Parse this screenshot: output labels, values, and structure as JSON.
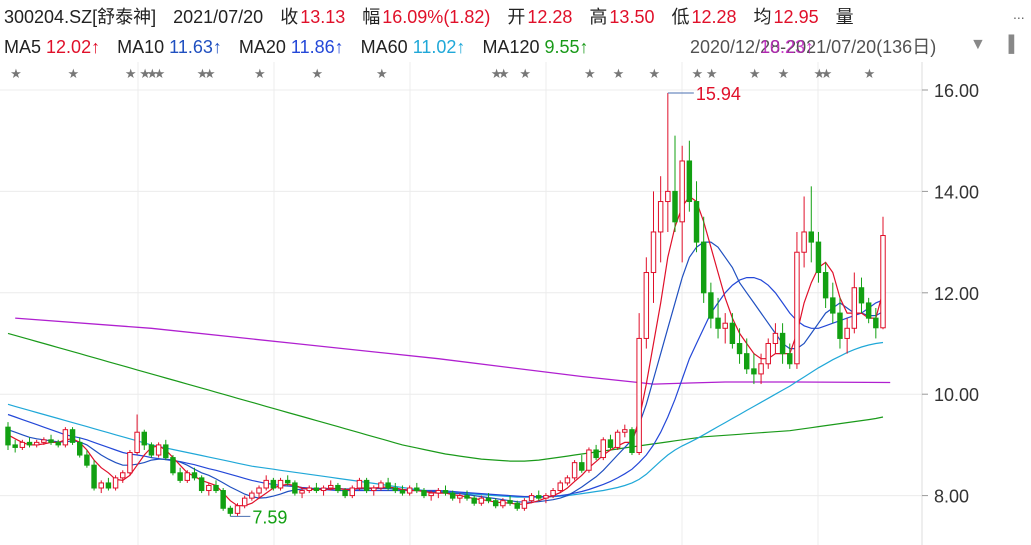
{
  "header": {
    "code": "300204.SZ[舒泰神]",
    "date": "2021/07/20",
    "close_label": "收",
    "close": "13.13",
    "change_label": "幅",
    "change": "16.09%(1.82)",
    "open_label": "开",
    "open": "12.28",
    "high_label": "高",
    "high": "13.50",
    "low_label": "低",
    "low": "12.28",
    "avg_label": "均",
    "avg": "12.95",
    "vol_label": "量",
    "more": "..."
  },
  "ma": [
    {
      "label": "MA5",
      "value": "12.02↑",
      "color": "#e0102a"
    },
    {
      "label": "MA10",
      "value": "11.63↑",
      "color": "#2050c0"
    },
    {
      "label": "MA20",
      "value": "11.86↑",
      "color": "#2448d8"
    },
    {
      "label": "MA60",
      "value": "11.02↑",
      "color": "#20a8d8"
    },
    {
      "label": "MA120",
      "value": "9.55↑",
      "color": "#1a9a1a"
    }
  ],
  "overlay": {
    "range_a": "2020/12/28-2021/07/20(136日)",
    "range_b": "10.23↑",
    "range_b_color": "#c020c0"
  },
  "controls": {
    "triangle": "▼",
    "bar_icon": "▐"
  },
  "colors": {
    "up": "#e0102a",
    "down": "#12a012",
    "ma5": "#e0102a",
    "ma10": "#2050c0",
    "ma20": "#2448d8",
    "ma60": "#20a8d8",
    "ma120": "#1a9a1a",
    "ma250": "#b020d0"
  },
  "chart_data": {
    "type": "candlestick",
    "yticks": [
      "16.00",
      "14.00",
      "12.00",
      "10.00",
      "8.00"
    ],
    "ylim": [
      7.4,
      16.3
    ],
    "annotations": [
      {
        "text": "15.94",
        "type": "max",
        "value": 15.94
      },
      {
        "text": "7.59",
        "type": "min",
        "value": 7.59
      }
    ],
    "candles": [
      [
        9.35,
        9.45,
        8.9,
        9.0
      ],
      [
        9.0,
        9.1,
        8.85,
        8.95
      ],
      [
        8.95,
        9.1,
        8.9,
        9.05
      ],
      [
        9.05,
        9.15,
        8.95,
        9.0
      ],
      [
        9.0,
        9.1,
        8.95,
        9.05
      ],
      [
        9.05,
        9.15,
        9.0,
        9.1
      ],
      [
        9.1,
        9.2,
        9.0,
        9.05
      ],
      [
        9.05,
        9.1,
        8.95,
        9.0
      ],
      [
        9.0,
        9.35,
        8.95,
        9.3
      ],
      [
        9.3,
        9.35,
        9.0,
        9.05
      ],
      [
        9.05,
        9.15,
        8.75,
        8.8
      ],
      [
        8.8,
        8.9,
        8.55,
        8.6
      ],
      [
        8.6,
        8.7,
        8.1,
        8.15
      ],
      [
        8.15,
        8.3,
        8.05,
        8.25
      ],
      [
        8.25,
        8.35,
        8.1,
        8.15
      ],
      [
        8.15,
        8.4,
        8.1,
        8.35
      ],
      [
        8.35,
        8.5,
        8.25,
        8.45
      ],
      [
        8.45,
        8.9,
        8.4,
        8.85
      ],
      [
        8.85,
        9.6,
        8.8,
        9.25
      ],
      [
        9.25,
        9.3,
        8.9,
        9.0
      ],
      [
        9.0,
        9.05,
        8.75,
        8.8
      ],
      [
        8.8,
        9.05,
        8.75,
        9.0
      ],
      [
        9.0,
        9.1,
        8.7,
        8.75
      ],
      [
        8.75,
        8.8,
        8.4,
        8.45
      ],
      [
        8.45,
        8.55,
        8.25,
        8.3
      ],
      [
        8.3,
        8.5,
        8.25,
        8.45
      ],
      [
        8.45,
        8.55,
        8.3,
        8.35
      ],
      [
        8.35,
        8.4,
        8.05,
        8.1
      ],
      [
        8.1,
        8.25,
        8.0,
        8.2
      ],
      [
        8.2,
        8.3,
        8.05,
        8.1
      ],
      [
        8.1,
        8.15,
        7.7,
        7.75
      ],
      [
        7.75,
        7.8,
        7.59,
        7.65
      ],
      [
        7.65,
        7.85,
        7.6,
        7.8
      ],
      [
        7.8,
        8.0,
        7.75,
        7.95
      ],
      [
        7.95,
        8.1,
        7.9,
        8.05
      ],
      [
        8.05,
        8.2,
        7.95,
        8.15
      ],
      [
        8.15,
        8.4,
        8.1,
        8.3
      ],
      [
        8.3,
        8.35,
        8.1,
        8.15
      ],
      [
        8.15,
        8.35,
        8.1,
        8.3
      ],
      [
        8.3,
        8.4,
        8.2,
        8.25
      ],
      [
        8.25,
        8.3,
        8.0,
        8.05
      ],
      [
        8.05,
        8.15,
        7.95,
        8.1
      ],
      [
        8.1,
        8.2,
        8.05,
        8.15
      ],
      [
        8.15,
        8.25,
        8.05,
        8.1
      ],
      [
        8.1,
        8.2,
        8.0,
        8.15
      ],
      [
        8.15,
        8.3,
        8.1,
        8.2
      ],
      [
        8.2,
        8.25,
        8.05,
        8.1
      ],
      [
        8.1,
        8.15,
        7.95,
        8.0
      ],
      [
        8.0,
        8.2,
        7.95,
        8.15
      ],
      [
        8.15,
        8.35,
        8.1,
        8.3
      ],
      [
        8.3,
        8.35,
        8.05,
        8.1
      ],
      [
        8.1,
        8.2,
        8.0,
        8.15
      ],
      [
        8.15,
        8.3,
        8.1,
        8.25
      ],
      [
        8.25,
        8.35,
        8.1,
        8.15
      ],
      [
        8.15,
        8.25,
        8.05,
        8.1
      ],
      [
        8.1,
        8.2,
        8.0,
        8.05
      ],
      [
        8.05,
        8.2,
        8.0,
        8.15
      ],
      [
        8.15,
        8.25,
        8.05,
        8.1
      ],
      [
        8.1,
        8.15,
        7.95,
        8.0
      ],
      [
        8.0,
        8.1,
        7.9,
        8.05
      ],
      [
        8.05,
        8.15,
        7.95,
        8.1
      ],
      [
        8.1,
        8.2,
        8.0,
        8.05
      ],
      [
        8.05,
        8.1,
        7.9,
        7.95
      ],
      [
        7.95,
        8.05,
        7.85,
        8.0
      ],
      [
        8.0,
        8.1,
        7.9,
        7.95
      ],
      [
        7.95,
        8.0,
        7.8,
        7.85
      ],
      [
        7.85,
        8.0,
        7.8,
        7.95
      ],
      [
        7.95,
        8.05,
        7.85,
        7.9
      ],
      [
        7.9,
        7.95,
        7.75,
        7.8
      ],
      [
        7.8,
        7.95,
        7.75,
        7.9
      ],
      [
        7.9,
        8.0,
        7.8,
        7.85
      ],
      [
        7.85,
        7.9,
        7.7,
        7.75
      ],
      [
        7.75,
        7.95,
        7.7,
        7.9
      ],
      [
        7.9,
        8.05,
        7.85,
        8.0
      ],
      [
        8.0,
        8.1,
        7.9,
        7.95
      ],
      [
        7.95,
        8.05,
        7.85,
        8.0
      ],
      [
        8.0,
        8.15,
        7.95,
        8.1
      ],
      [
        8.1,
        8.3,
        8.05,
        8.25
      ],
      [
        8.25,
        8.4,
        8.2,
        8.35
      ],
      [
        8.35,
        8.7,
        8.3,
        8.65
      ],
      [
        8.65,
        8.8,
        8.45,
        8.5
      ],
      [
        8.5,
        8.95,
        8.45,
        8.9
      ],
      [
        8.9,
        9.0,
        8.7,
        8.75
      ],
      [
        8.75,
        9.15,
        8.7,
        9.1
      ],
      [
        9.1,
        9.2,
        8.9,
        8.95
      ],
      [
        8.95,
        9.3,
        8.9,
        9.25
      ],
      [
        9.25,
        9.4,
        9.15,
        9.3
      ],
      [
        9.3,
        9.35,
        8.8,
        8.85
      ],
      [
        8.85,
        11.6,
        8.8,
        11.1
      ],
      [
        11.1,
        12.7,
        10.9,
        12.4
      ],
      [
        12.4,
        14.0,
        11.8,
        13.2
      ],
      [
        13.2,
        14.3,
        12.6,
        13.8
      ],
      [
        13.8,
        15.94,
        13.2,
        14.0
      ],
      [
        14.0,
        15.1,
        13.2,
        13.4
      ],
      [
        13.4,
        14.9,
        12.6,
        14.6
      ],
      [
        14.6,
        15.0,
        13.6,
        13.8
      ],
      [
        13.8,
        14.2,
        12.8,
        13.0
      ],
      [
        13.0,
        13.5,
        11.8,
        12.0
      ],
      [
        12.0,
        12.2,
        11.3,
        11.5
      ],
      [
        11.5,
        11.9,
        11.1,
        11.3
      ],
      [
        11.3,
        11.6,
        11.0,
        11.4
      ],
      [
        11.4,
        11.6,
        10.9,
        11.0
      ],
      [
        11.0,
        11.3,
        10.6,
        10.8
      ],
      [
        10.8,
        11.1,
        10.4,
        10.5
      ],
      [
        10.5,
        10.8,
        10.2,
        10.4
      ],
      [
        10.4,
        10.8,
        10.2,
        10.6
      ],
      [
        10.6,
        11.1,
        10.5,
        11.0
      ],
      [
        11.0,
        11.4,
        10.8,
        11.2
      ],
      [
        11.2,
        11.4,
        10.6,
        10.8
      ],
      [
        10.8,
        11.0,
        10.5,
        10.6
      ],
      [
        10.6,
        13.2,
        10.5,
        12.8
      ],
      [
        12.8,
        13.9,
        12.5,
        13.2
      ],
      [
        13.2,
        14.1,
        12.6,
        13.0
      ],
      [
        13.0,
        13.2,
        12.2,
        12.4
      ],
      [
        12.4,
        12.6,
        11.7,
        11.9
      ],
      [
        11.9,
        12.2,
        11.4,
        11.6
      ],
      [
        11.6,
        11.9,
        10.9,
        11.1
      ],
      [
        11.1,
        11.5,
        10.8,
        11.3
      ],
      [
        11.3,
        12.4,
        11.2,
        12.1
      ],
      [
        12.1,
        12.3,
        11.6,
        11.8
      ],
      [
        11.8,
        11.9,
        11.4,
        11.5
      ],
      [
        11.5,
        11.7,
        11.1,
        11.31
      ],
      [
        11.31,
        13.5,
        11.28,
        13.13
      ]
    ],
    "ma5": [
      9.2,
      9.12,
      9.05,
      9.0,
      9.0,
      9.02,
      9.05,
      9.05,
      9.1,
      9.12,
      9.05,
      8.9,
      8.7,
      8.55,
      8.45,
      8.32,
      8.3,
      8.4,
      8.6,
      8.8,
      8.95,
      8.98,
      8.9,
      8.75,
      8.6,
      8.45,
      8.38,
      8.3,
      8.25,
      8.2,
      8.05,
      7.9,
      7.8,
      7.8,
      7.85,
      7.95,
      8.05,
      8.15,
      8.2,
      8.22,
      8.2,
      8.15,
      8.12,
      8.12,
      8.12,
      8.13,
      8.14,
      8.12,
      8.12,
      8.15,
      8.15,
      8.15,
      8.16,
      8.17,
      8.15,
      8.12,
      8.1,
      8.1,
      8.08,
      8.06,
      8.05,
      8.05,
      8.02,
      8.0,
      7.97,
      7.94,
      7.92,
      7.9,
      7.87,
      7.86,
      7.85,
      7.83,
      7.83,
      7.86,
      7.9,
      7.95,
      8.0,
      8.06,
      8.15,
      8.28,
      8.4,
      8.55,
      8.67,
      8.8,
      8.9,
      8.98,
      9.05,
      9.05,
      9.5,
      10.2,
      11.0,
      11.8,
      12.7,
      13.3,
      13.7,
      13.9,
      13.8,
      13.4,
      12.9,
      12.4,
      11.9,
      11.5,
      11.2,
      11.0,
      10.8,
      10.7,
      10.7,
      10.8,
      10.8,
      10.8,
      11.2,
      11.8,
      12.2,
      12.5,
      12.6,
      12.4,
      11.9,
      11.6,
      11.6,
      11.6,
      11.5,
      11.5,
      12.02
    ],
    "ma10": [
      9.3,
      9.25,
      9.2,
      9.15,
      9.12,
      9.1,
      9.08,
      9.06,
      9.06,
      9.08,
      9.06,
      9.0,
      8.9,
      8.8,
      8.72,
      8.65,
      8.6,
      8.6,
      8.62,
      8.65,
      8.7,
      8.72,
      8.72,
      8.7,
      8.66,
      8.6,
      8.52,
      8.45,
      8.4,
      8.33,
      8.25,
      8.17,
      8.1,
      8.03,
      7.98,
      7.95,
      7.96,
      7.99,
      8.03,
      8.08,
      8.11,
      8.13,
      8.14,
      8.14,
      8.14,
      8.14,
      8.14,
      8.13,
      8.13,
      8.13,
      8.14,
      8.14,
      8.14,
      8.14,
      8.13,
      8.12,
      8.11,
      8.1,
      8.09,
      8.08,
      8.07,
      8.06,
      8.05,
      8.04,
      8.02,
      8.0,
      7.98,
      7.96,
      7.94,
      7.92,
      7.9,
      7.88,
      7.87,
      7.87,
      7.88,
      7.9,
      7.92,
      7.95,
      8.0,
      8.08,
      8.17,
      8.27,
      8.37,
      8.5,
      8.65,
      8.8,
      8.95,
      9.1,
      9.4,
      9.8,
      10.3,
      10.8,
      11.3,
      11.8,
      12.3,
      12.7,
      12.9,
      13.0,
      13.0,
      12.9,
      12.7,
      12.5,
      12.2,
      12.0,
      11.8,
      11.6,
      11.4,
      11.2,
      11.0,
      10.9,
      10.9,
      11.0,
      11.2,
      11.4,
      11.6,
      11.7,
      11.8,
      11.7,
      11.6,
      11.6,
      11.55,
      11.55,
      11.63
    ],
    "ma20": [
      9.6,
      9.55,
      9.5,
      9.45,
      9.4,
      9.35,
      9.3,
      9.25,
      9.2,
      9.17,
      9.14,
      9.1,
      9.05,
      9.0,
      8.95,
      8.9,
      8.85,
      8.82,
      8.8,
      8.78,
      8.75,
      8.73,
      8.71,
      8.69,
      8.67,
      8.64,
      8.61,
      8.57,
      8.53,
      8.5,
      8.46,
      8.42,
      8.38,
      8.34,
      8.3,
      8.27,
      8.24,
      8.22,
      8.2,
      8.19,
      8.18,
      8.16,
      8.15,
      8.13,
      8.12,
      8.11,
      8.1,
      8.1,
      8.1,
      8.1,
      8.1,
      8.1,
      8.1,
      8.1,
      8.1,
      8.1,
      8.1,
      8.1,
      8.1,
      8.1,
      8.1,
      8.09,
      8.08,
      8.07,
      8.06,
      8.05,
      8.04,
      8.03,
      8.02,
      8.01,
      8.0,
      7.99,
      7.98,
      7.98,
      7.98,
      7.98,
      7.99,
      8.0,
      8.02,
      8.05,
      8.08,
      8.12,
      8.17,
      8.22,
      8.28,
      8.35,
      8.43,
      8.52,
      8.65,
      8.8,
      9.0,
      9.25,
      9.55,
      9.9,
      10.3,
      10.7,
      11.0,
      11.3,
      11.6,
      11.8,
      12.0,
      12.15,
      12.25,
      12.3,
      12.3,
      12.25,
      12.15,
      12.0,
      11.8,
      11.6,
      11.45,
      11.35,
      11.3,
      11.3,
      11.35,
      11.4,
      11.45,
      11.5,
      11.55,
      11.6,
      11.7,
      11.8,
      11.86
    ],
    "ma60": [
      9.8,
      9.76,
      9.72,
      9.68,
      9.64,
      9.6,
      9.56,
      9.52,
      9.48,
      9.44,
      9.4,
      9.36,
      9.32,
      9.28,
      9.24,
      9.2,
      9.16,
      9.12,
      9.08,
      9.04,
      9.0,
      8.97,
      8.94,
      8.91,
      8.88,
      8.85,
      8.82,
      8.79,
      8.76,
      8.73,
      8.7,
      8.67,
      8.64,
      8.61,
      8.58,
      8.56,
      8.54,
      8.52,
      8.5,
      8.48,
      8.46,
      8.44,
      8.42,
      8.4,
      8.38,
      8.36,
      8.34,
      8.32,
      8.3,
      8.28,
      8.26,
      8.24,
      8.22,
      8.2,
      8.18,
      8.16,
      8.14,
      8.12,
      8.1,
      8.09,
      8.08,
      8.07,
      8.06,
      8.05,
      8.04,
      8.03,
      8.02,
      8.01,
      8.0,
      7.99,
      7.98,
      7.97,
      7.97,
      7.97,
      7.97,
      7.97,
      7.98,
      7.99,
      8.0,
      8.02,
      8.04,
      8.06,
      8.08,
      8.1,
      8.13,
      8.16,
      8.2,
      8.25,
      8.32,
      8.42,
      8.55,
      8.68,
      8.8,
      8.9,
      8.98,
      9.05,
      9.12,
      9.2,
      9.28,
      9.36,
      9.44,
      9.52,
      9.6,
      9.68,
      9.76,
      9.84,
      9.92,
      10.0,
      10.08,
      10.16,
      10.25,
      10.34,
      10.43,
      10.52,
      10.6,
      10.68,
      10.75,
      10.82,
      10.88,
      10.93,
      10.97,
      11.0,
      11.02
    ],
    "ma120": [
      11.2,
      11.16,
      11.12,
      11.08,
      11.04,
      11.0,
      10.96,
      10.92,
      10.88,
      10.84,
      10.8,
      10.76,
      10.72,
      10.68,
      10.64,
      10.6,
      10.56,
      10.52,
      10.48,
      10.44,
      10.4,
      10.36,
      10.32,
      10.28,
      10.24,
      10.2,
      10.16,
      10.12,
      10.08,
      10.04,
      10.0,
      9.96,
      9.92,
      9.88,
      9.84,
      9.8,
      9.76,
      9.72,
      9.68,
      9.64,
      9.6,
      9.56,
      9.52,
      9.48,
      9.44,
      9.4,
      9.36,
      9.32,
      9.28,
      9.24,
      9.2,
      9.16,
      9.12,
      9.08,
      9.04,
      9.0,
      8.97,
      8.94,
      8.91,
      8.88,
      8.85,
      8.82,
      8.8,
      8.78,
      8.76,
      8.74,
      8.72,
      8.71,
      8.7,
      8.69,
      8.68,
      8.68,
      8.68,
      8.69,
      8.7,
      8.72,
      8.74,
      8.76,
      8.78,
      8.8,
      8.82,
      8.84,
      8.86,
      8.88,
      8.9,
      8.92,
      8.94,
      8.96,
      8.98,
      9.0,
      9.02,
      9.04,
      9.06,
      9.08,
      9.1,
      9.12,
      9.14,
      9.16,
      9.17,
      9.18,
      9.19,
      9.2,
      9.21,
      9.22,
      9.23,
      9.24,
      9.25,
      9.26,
      9.27,
      9.28,
      9.3,
      9.32,
      9.34,
      9.36,
      9.38,
      9.4,
      9.42,
      9.44,
      9.46,
      9.48,
      9.5,
      9.52,
      9.55
    ],
    "ma250_points": [
      [
        1,
        11.5
      ],
      [
        20,
        11.3
      ],
      [
        40,
        11.0
      ],
      [
        60,
        10.7
      ],
      [
        80,
        10.35
      ],
      [
        90,
        10.2
      ],
      [
        95,
        10.22
      ],
      [
        100,
        10.24
      ],
      [
        110,
        10.24
      ],
      [
        123,
        10.23
      ]
    ],
    "stars": [
      1,
      9,
      17,
      19,
      20,
      21,
      27,
      28,
      35,
      43,
      52,
      68,
      69,
      72,
      81,
      85,
      90,
      96,
      98,
      104,
      108,
      113,
      114,
      120
    ]
  }
}
